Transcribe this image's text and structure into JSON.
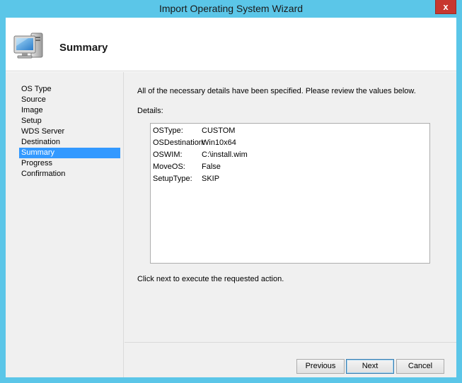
{
  "window": {
    "title": "Import Operating System Wizard",
    "close_glyph": "x"
  },
  "header": {
    "title": "Summary",
    "icon": "computer-monitor-icon"
  },
  "sidebar": {
    "items": [
      {
        "label": "OS Type",
        "selected": false
      },
      {
        "label": "Source",
        "selected": false
      },
      {
        "label": "Image",
        "selected": false
      },
      {
        "label": "Setup",
        "selected": false
      },
      {
        "label": "WDS Server",
        "selected": false
      },
      {
        "label": "Destination",
        "selected": false
      },
      {
        "label": "Summary",
        "selected": true
      },
      {
        "label": "Progress",
        "selected": false
      },
      {
        "label": "Confirmation",
        "selected": false
      }
    ]
  },
  "content": {
    "intro": "All of the necessary details have been specified.  Please review the values below.",
    "details_label": "Details:",
    "details": [
      {
        "key": "OSType:",
        "value": "CUSTOM"
      },
      {
        "key": "OSDestination:",
        "value": "Win10x64"
      },
      {
        "key": "OSWIM:",
        "value": "C:\\install.wim"
      },
      {
        "key": "MoveOS:",
        "value": "False"
      },
      {
        "key": "SetupType:",
        "value": "SKIP"
      }
    ],
    "footer": "Click next to execute the requested action."
  },
  "buttons": {
    "previous": "Previous",
    "next": "Next",
    "cancel": "Cancel"
  },
  "colors": {
    "frame": "#5bc6e8",
    "close": "#c7372f",
    "selection": "#3399ff"
  }
}
